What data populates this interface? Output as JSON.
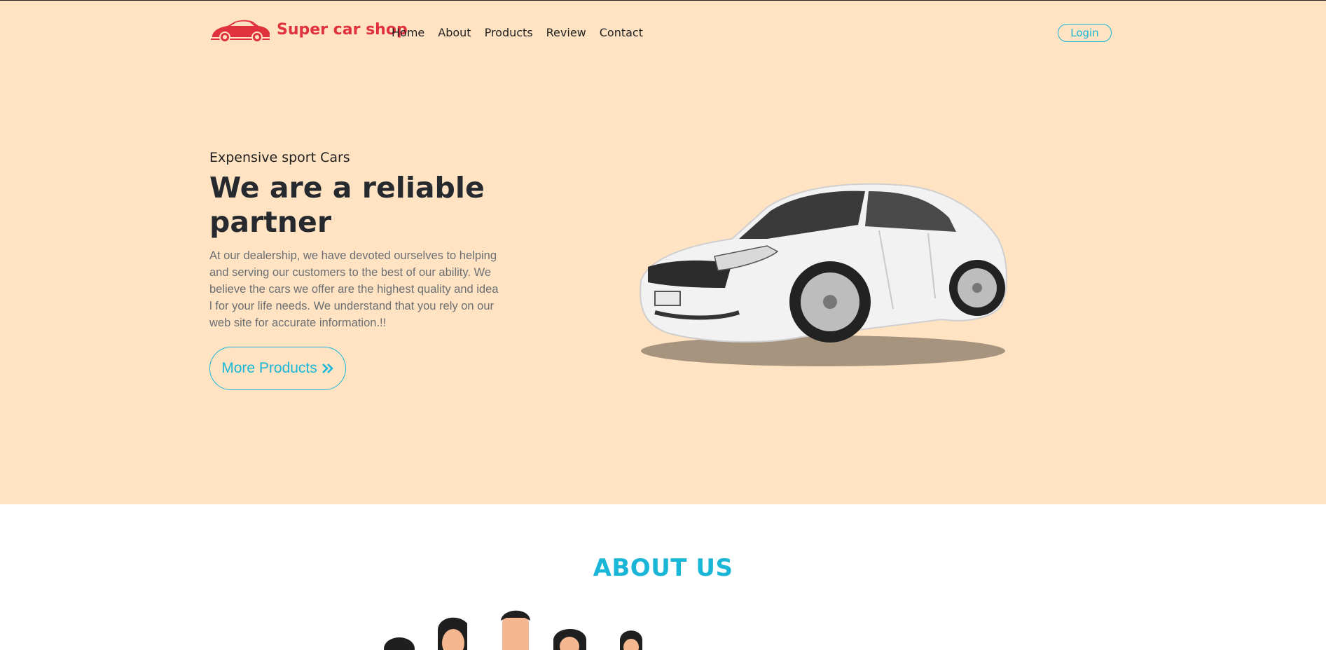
{
  "brand": {
    "name": "Super car shop",
    "color": "#e0323c"
  },
  "nav": {
    "items": [
      "Home",
      "About",
      "Products",
      "Review",
      "Contact"
    ]
  },
  "header": {
    "login_label": "Login"
  },
  "hero": {
    "kicker": "Expensive sport Cars",
    "headline": "We are a reliable partner",
    "description": "At our dealership, we have devoted ourselves to helping and serving our customers to the best of our ability. We believe the cars we offer are the highest quality and idea l for your life needs. We understand that you rely on our web site for accurate information.!!",
    "cta_label": "More Products",
    "cta_icon": "double-chevron-right-icon",
    "image": "white-sedan-car",
    "background": "#ffe3c3"
  },
  "about": {
    "title": "ABOUT US",
    "image": "team-illustration"
  },
  "colors": {
    "accent": "#19b6d8",
    "brand": "#e0323c"
  }
}
